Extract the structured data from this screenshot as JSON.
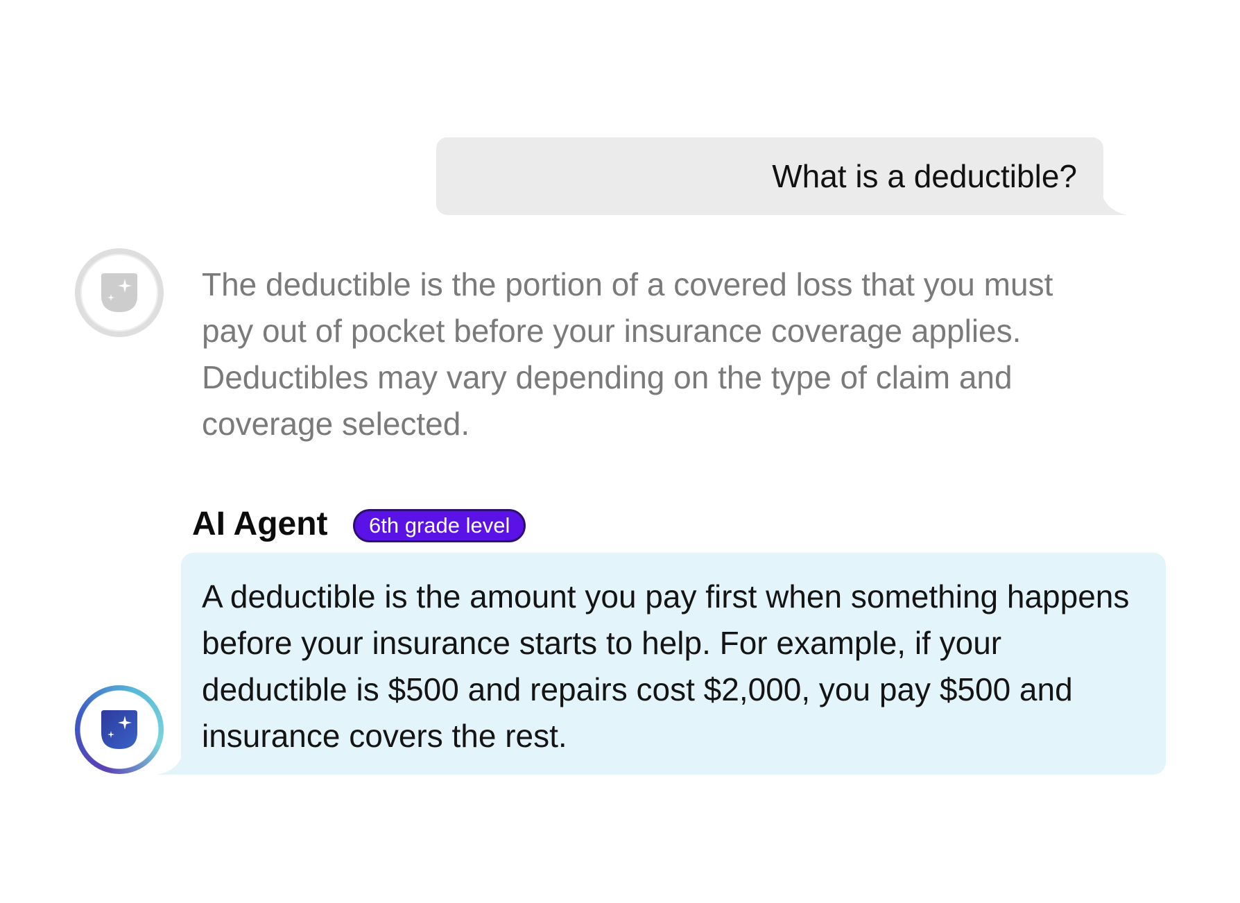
{
  "user_message": {
    "text": "What is a deductible?"
  },
  "original_response": {
    "text": "The deductible is the portion of a covered loss that you must pay out of pocket before your insurance coverage applies. Deductibles may vary depending on the type of claim and coverage selected."
  },
  "agent": {
    "name": "AI Agent",
    "badge": "6th grade level",
    "response": "A deductible is the amount you pay first when something happens before your insurance starts to help. For example, if your deductible is $500 and repairs cost $2,000, you pay $500 and insurance covers the rest."
  },
  "icons": {
    "original_avatar": "shield-sparkle-icon",
    "agent_avatar": "shield-sparkle-icon"
  },
  "colors": {
    "user_bubble": "#ebebeb",
    "agent_bubble": "#e3f4fa",
    "badge": "#5a12e6",
    "muted_text": "#7a7a7a",
    "agent_shield": "#2b3f9e"
  }
}
